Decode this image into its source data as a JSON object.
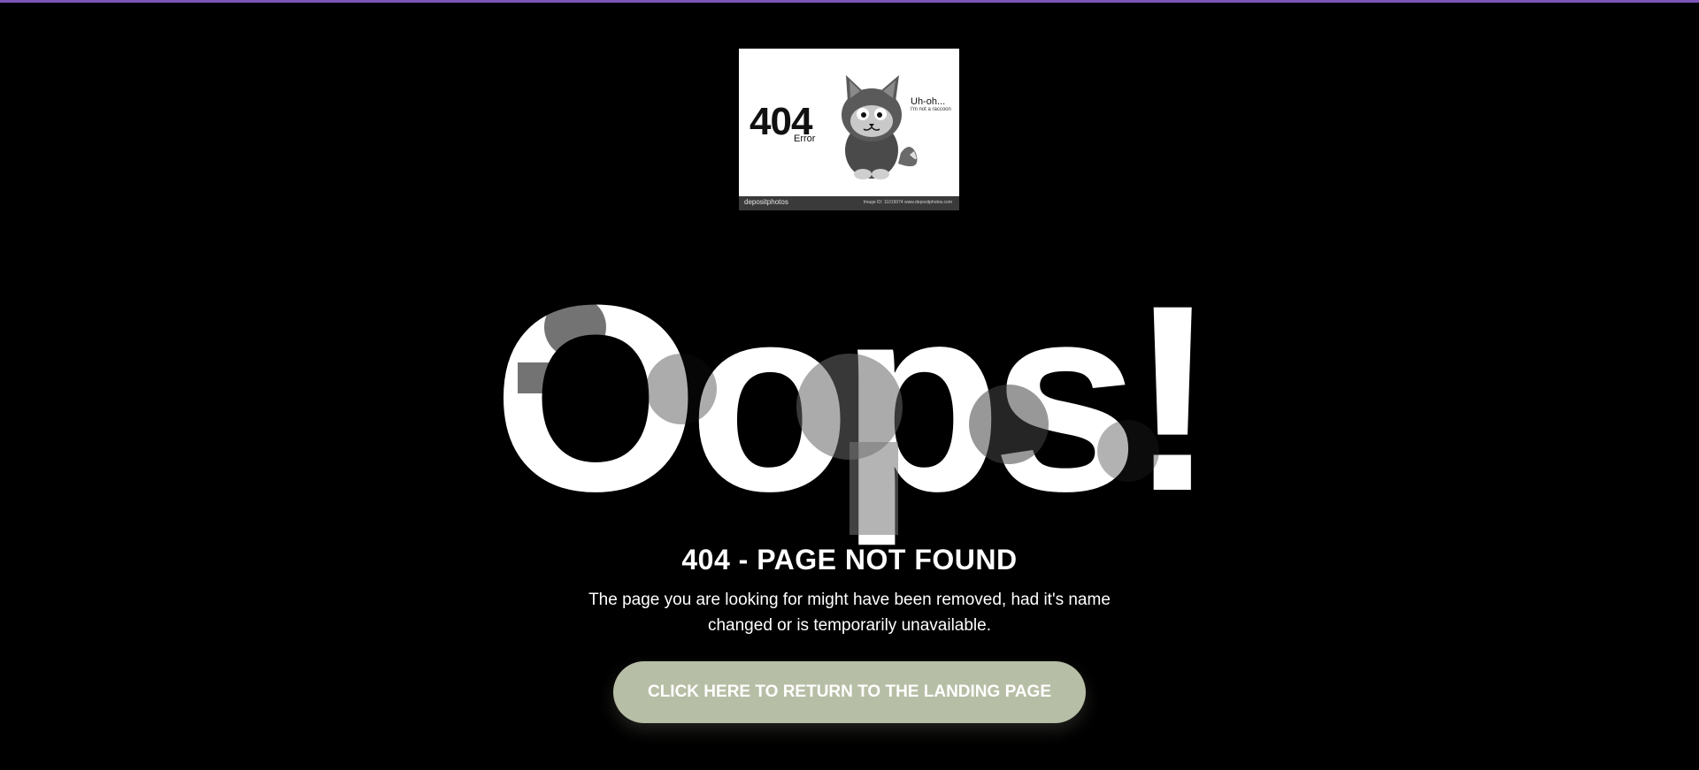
{
  "hero": {
    "text_404": "404",
    "text_error": "Error",
    "text_uhoh": "Uh-oh...",
    "text_uhoh_small": "I'm not a raccoon",
    "brand": "depositphotos",
    "icon": "cat-illustration",
    "meta": "Image ID: 11015074 www.depositphotos.com"
  },
  "headline": {
    "text": "Oops!"
  },
  "content": {
    "title": "404 - PAGE NOT FOUND",
    "description": "The page you are looking for might have been removed, had it's name changed or is temporarily unavailable."
  },
  "cta": {
    "label": "CLICK HERE TO RETURN TO THE LANDING PAGE"
  },
  "colors": {
    "background": "#000000",
    "accent": "#7d55b8",
    "cta": "#b7bea6",
    "text": "#ffffff"
  }
}
